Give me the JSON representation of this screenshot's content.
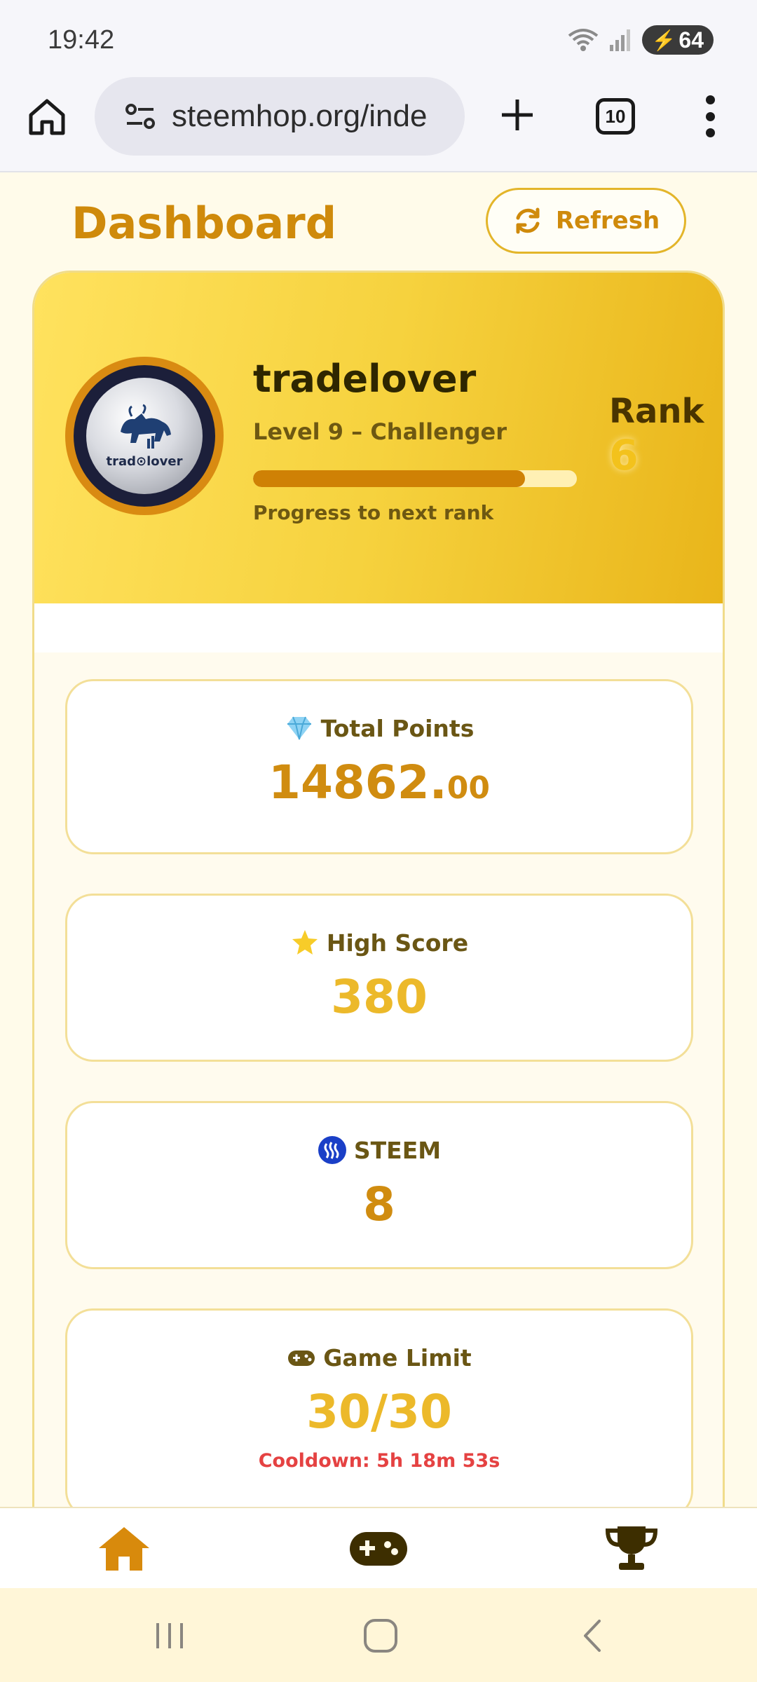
{
  "status_bar": {
    "time": "19:42",
    "battery": "64"
  },
  "browser": {
    "url": "steemhop.org/inde",
    "tab_count": "10"
  },
  "header": {
    "title": "Dashboard",
    "refresh_label": "Refresh"
  },
  "profile": {
    "avatar_text": "trad⊙lover",
    "username": "tradelover",
    "level": "Level 9 – Challenger",
    "progress_fraction": 0.84,
    "progress_label": "Progress to next rank",
    "rank_label": "Rank",
    "rank_value": "6"
  },
  "stats": {
    "points": {
      "label": "Total Points",
      "value_int": "14862.",
      "value_dec": "00",
      "icon": "gem-icon"
    },
    "high_score": {
      "label": "High Score",
      "value": "380",
      "icon": "star-icon"
    },
    "steem": {
      "label": "STEEM",
      "value": "8",
      "icon": "steem-logo-icon"
    },
    "game_limit": {
      "label": "Game Limit",
      "value": "30/30",
      "cooldown": "Cooldown: 5h 18m 53s",
      "icon": "gamepad-icon"
    }
  },
  "bottom_nav": {
    "items": [
      {
        "icon": "home-icon",
        "active": true
      },
      {
        "icon": "gamepad-icon",
        "active": false
      },
      {
        "icon": "trophy-icon",
        "active": false
      }
    ]
  },
  "colors": {
    "accent": "#cf8a0b",
    "gold": "#ecb92a",
    "hero_start": "#ffe25e",
    "hero_end": "#e9b51a",
    "danger": "#e54242"
  }
}
